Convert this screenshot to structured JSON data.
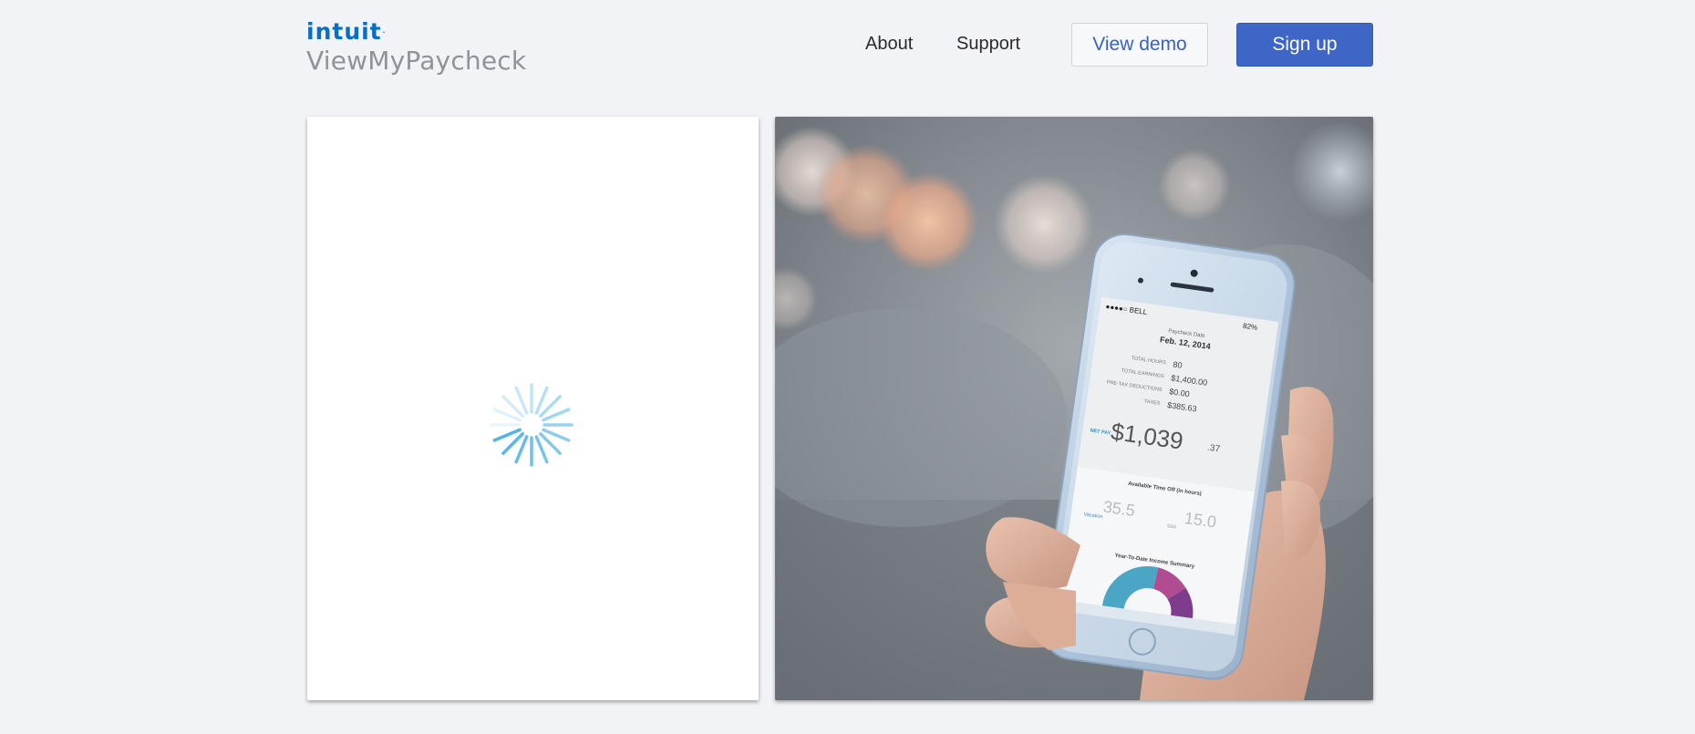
{
  "brand": {
    "company_logo": "intuit",
    "product_name": "ViewMyPaycheck"
  },
  "nav": {
    "about": "About",
    "support": "Support"
  },
  "buttons": {
    "view_demo": "View demo",
    "sign_up": "Sign up"
  },
  "login_panel": {
    "state": "loading",
    "icon": "loading-spinner-icon"
  },
  "hero_phone": {
    "carrier": "BELL",
    "battery": "82%",
    "paycheck_date_label": "Paycheck Date",
    "paycheck_date": "Feb. 12, 2014",
    "rows": [
      {
        "label": "TOTAL HOURS",
        "value": "80"
      },
      {
        "label": "TOTAL EARNINGS",
        "value": "$1,400.00"
      },
      {
        "label": "PRE-TAX DEDUCTIONS",
        "value": "$0.00"
      },
      {
        "label": "TAXES",
        "value": "$385.63"
      }
    ],
    "net_pay_label": "NET PAY",
    "net_pay_dollars": "$1,039",
    "net_pay_cents": ".37",
    "time_off_title": "Available Time Off (in hours)",
    "vacation_label": "Vacation",
    "vacation_value": "35.5",
    "sick_label": "Sick",
    "sick_value": "15.0",
    "ytd_title": "Year-To-Date Income Summary",
    "donut_colors": [
      "#4aa6c4",
      "#b14c92",
      "#7d3d8c"
    ]
  },
  "colors": {
    "background": "#f2f3f6",
    "brand_blue": "#0b6ec5",
    "primary_button": "#3d66c7",
    "spinner": "#52b3e6"
  }
}
